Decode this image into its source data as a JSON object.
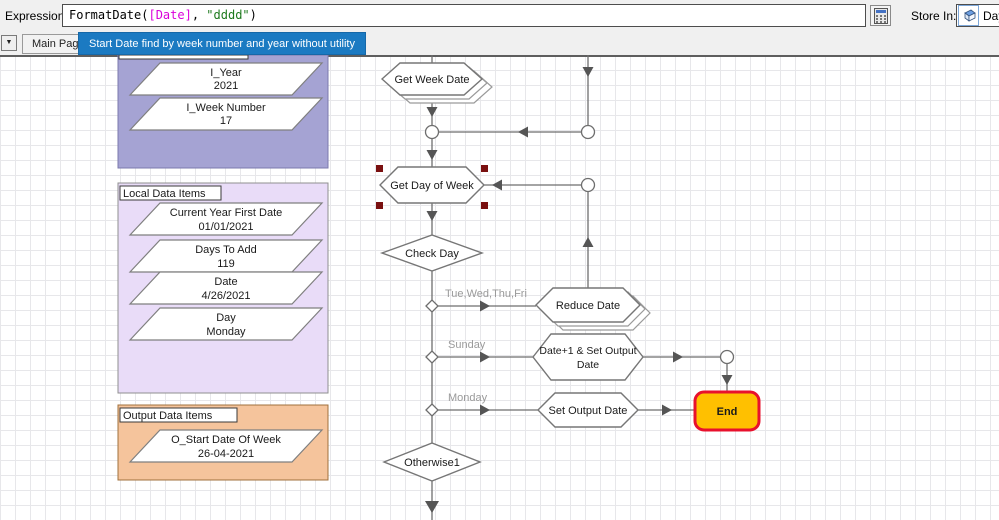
{
  "expression_bar": {
    "label": "Expression:",
    "expression": {
      "func": "FormatDate(",
      "param": "[Date]",
      "separator": ", ",
      "literal": "\"dddd\"",
      "close": ")"
    },
    "store_in_label": "Store In:",
    "store_in_value": "Day"
  },
  "tabs": {
    "dropdown_glyph": "▼",
    "main_page": "Main Page",
    "active_tab": "Start Date find by week number and year without utility"
  },
  "blocks": {
    "input": {
      "items": [
        {
          "name": "I_Year",
          "value": "2021"
        },
        {
          "name": "I_Week Number",
          "value": "17"
        }
      ]
    },
    "local": {
      "label": "Local Data Items",
      "items": [
        {
          "name": "Current Year First Date",
          "value": "01/01/2021"
        },
        {
          "name": "Days To Add",
          "value": "119"
        },
        {
          "name": "Date",
          "value": "4/26/2021"
        },
        {
          "name": "Day",
          "value": "Monday"
        }
      ]
    },
    "output": {
      "label": "Output Data Items",
      "items": [
        {
          "name": "O_Start Date Of Week",
          "value": "26-04-2021"
        }
      ]
    }
  },
  "flow": {
    "get_week_date": "Get Week Date",
    "get_day_of_week": "Get Day of Week",
    "check_day": "Check Day",
    "reduce_date": "Reduce Date",
    "date_plus1_line1": "Date+1 & Set Output",
    "date_plus1_line2": "Date",
    "set_output_date": "Set Output Date",
    "end": "End",
    "otherwise": "Otherwise1",
    "branch_tue": "Tue,Wed,Thu,Fri",
    "branch_sunday": "Sunday",
    "branch_monday": "Monday"
  },
  "colors": {
    "active_tab": "#1b7ac2",
    "expression_param": "#da00da",
    "expression_literal": "#1e7a1e",
    "input_block_fill": "#a5a3d3",
    "local_block_fill": "#e9dcf8",
    "output_block_fill": "#f5c49c",
    "end_fill": "#ffc000",
    "end_border": "#e8112d",
    "selection_handle": "#7a1010"
  }
}
